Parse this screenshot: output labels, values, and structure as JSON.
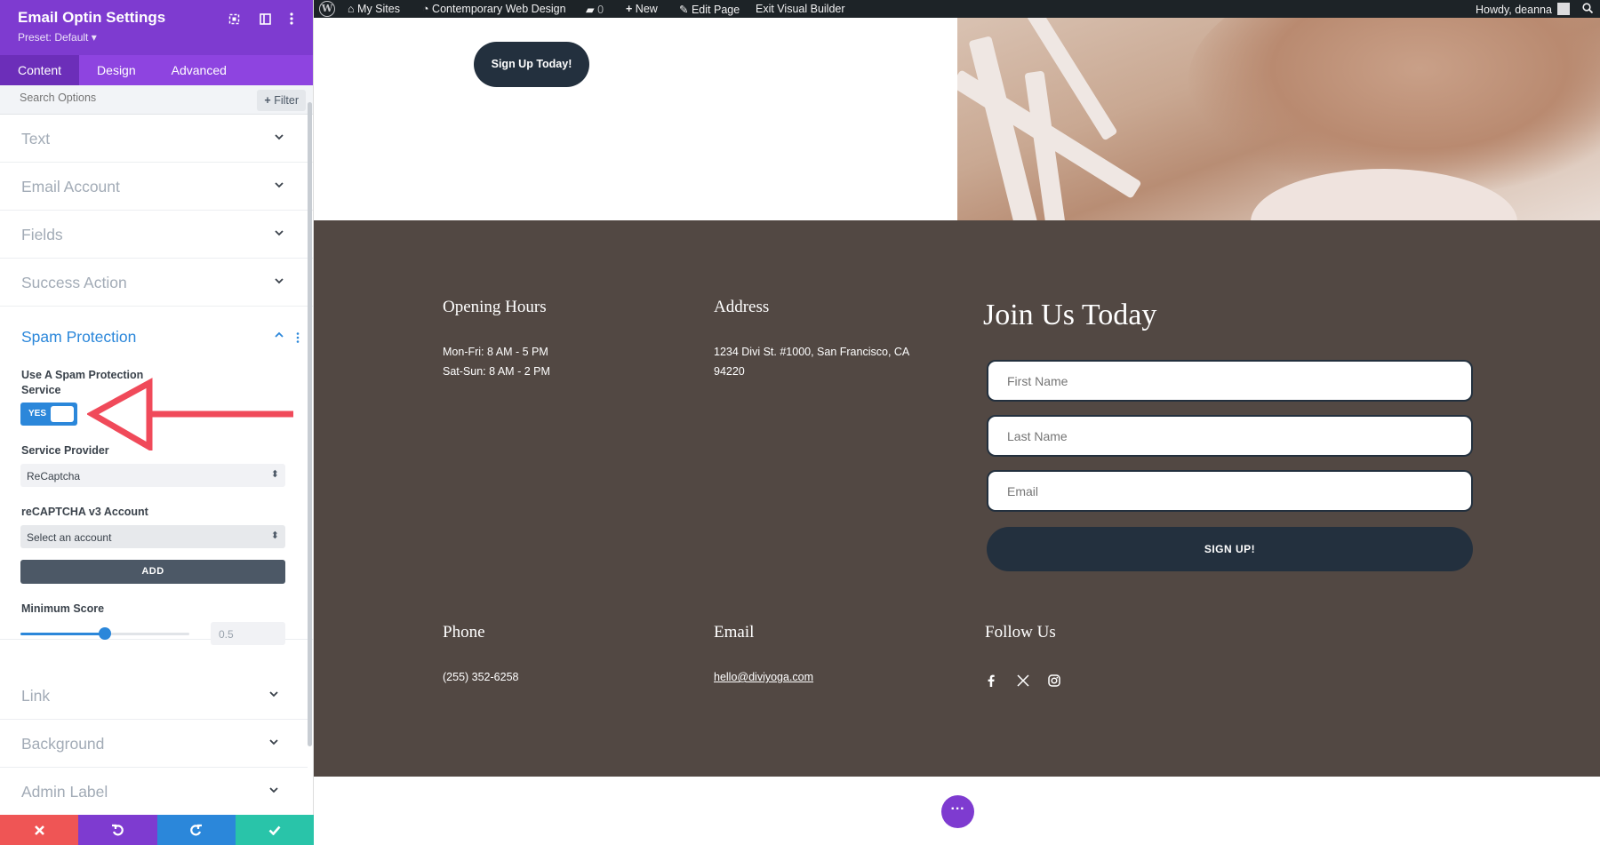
{
  "panel": {
    "title": "Email Optin Settings",
    "preset": "Preset: Default ▾",
    "tabs": [
      "Content",
      "Design",
      "Advanced"
    ],
    "search_placeholder": "Search Options",
    "filter_label": "Filter",
    "sections": {
      "text": "Text",
      "email_account": "Email Account",
      "fields": "Fields",
      "success_action": "Success Action",
      "spam_protection": "Spam Protection",
      "link": "Link",
      "background": "Background",
      "admin_label": "Admin Label"
    },
    "spam": {
      "use_service_label": "Use A Spam Protection Service",
      "toggle_label": "YES",
      "toggle_on": true,
      "service_provider_label": "Service Provider",
      "service_provider_value": "ReCaptcha",
      "account_label": "reCAPTCHA v3 Account",
      "account_value": "Select an account",
      "add_button": "ADD",
      "min_score_label": "Minimum Score",
      "min_score_value": "0.5",
      "min_score_fraction": 0.5
    },
    "bottom_bar": {
      "discard_color": "#ef5555",
      "undo_color": "#7e3bd0",
      "redo_color": "#2b87da",
      "save_color": "#29c4a9"
    },
    "accent": "#7e3bd0"
  },
  "adminbar": {
    "my_sites": "My Sites",
    "site_name": "Contemporary Web Design",
    "comments_count": "0",
    "new": "New",
    "edit_page": "Edit Page",
    "exit_builder": "Exit Visual Builder",
    "howdy": "Howdy, deanna"
  },
  "hero": {
    "signup_button": "Sign Up Today!"
  },
  "footer": {
    "opening_hours_title": "Opening Hours",
    "hours_weekday": "Mon-Fri: 8 AM - 5 PM",
    "hours_weekend": "Sat-Sun: 8 AM - 2 PM",
    "address_title": "Address",
    "address_line1": "1234 Divi St. #1000, San Francisco, CA",
    "address_line2": "94220",
    "join_title": "Join Us Today",
    "first_name_placeholder": "First Name",
    "last_name_placeholder": "Last Name",
    "email_placeholder": "Email",
    "signup_button": "SIGN UP!",
    "phone_title": "Phone",
    "phone": "(255) 352-6258",
    "email_title": "Email",
    "email": "hello@diviyoga.com",
    "follow_title": "Follow Us",
    "social_icons": [
      "facebook-icon",
      "x-icon",
      "instagram-icon"
    ],
    "background": "#524843",
    "button_color": "#23303e"
  }
}
